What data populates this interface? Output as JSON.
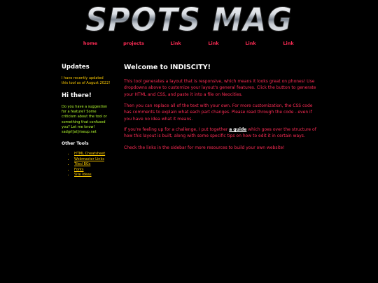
{
  "header": {
    "logo_text": "SPOTS MAG"
  },
  "nav": {
    "items": [
      {
        "label": "home"
      },
      {
        "label": "projects"
      },
      {
        "label": "Link"
      },
      {
        "label": "Link"
      },
      {
        "label": "Link"
      },
      {
        "label": "Link"
      }
    ]
  },
  "sidebar": {
    "updates_title": "Updates",
    "updates_text": "I have recently updated this tool as of August 2022!",
    "hi_title": "Hi there!",
    "hi_text": "Do you have a suggestion for a feature? Some criticism about the tool or something that confused you? Let me know! sadgrl[at]riseup.net",
    "other_title": "Other Tools",
    "other_links": [
      {
        "label": "HTML Cheatsheet"
      },
      {
        "label": "Webmaster Links"
      },
      {
        "label": "Tiled BGs"
      },
      {
        "label": "Fonts"
      },
      {
        "label": "Site Ideas"
      }
    ]
  },
  "main": {
    "title": "Welcome to INDISCITY!",
    "p1": "This tool generates a layout that is responsive, which means it looks great on phones! Use dropdowns above to customize your layout's general features. Click the button to generate your HTML and CSS, and paste it into a file on Neocities.",
    "p2": "Then you can replace all of the text with your own. For more customization, the CSS code has comments to explain what each part changes. Please read through the code - even if you have no idea what it means.",
    "p3_before": "If you're feeling up for a challenge, I put together ",
    "p3_link": "a guide",
    "p3_after": " which goes over the structure of how this layout is built, along with some specific tips on how to edit it in certain ways.",
    "p4": "Check the links in the sidebar for more resources to build your own website!"
  },
  "colors": {
    "background": "#000000",
    "accent": "#ff2b55",
    "sidebar_yellow": "#ffcc00",
    "sidebar_green": "#b6ff2e"
  }
}
